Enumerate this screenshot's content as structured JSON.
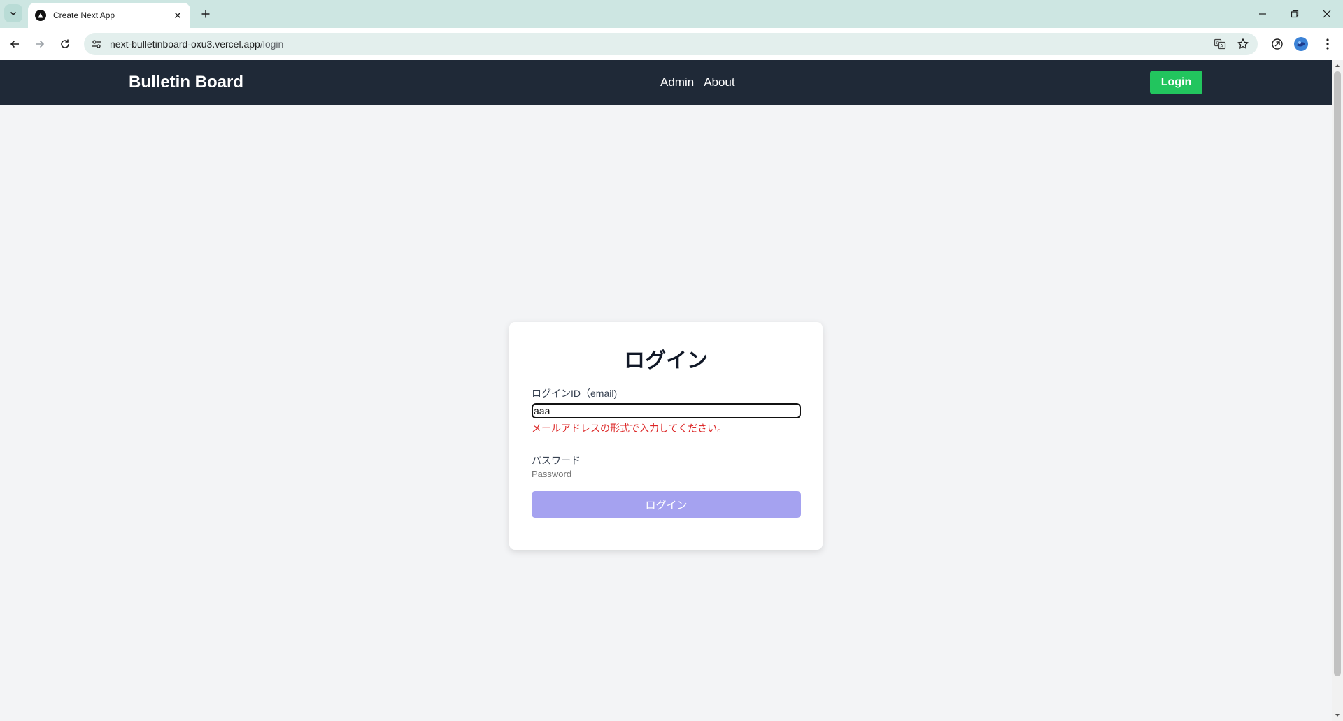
{
  "browser": {
    "tab_title": "Create Next App",
    "url_host": "next-bulletinboard-oxu3.vercel.app",
    "url_path": "/login"
  },
  "site": {
    "brand": "Bulletin Board",
    "nav": [
      "Admin",
      "About"
    ],
    "login_button": "Login"
  },
  "login_form": {
    "title": "ログイン",
    "email_label": "ログインID（email)",
    "email_value": "aaa",
    "email_error": "メールアドレスの形式で入力してください。",
    "password_label": "パスワード",
    "password_placeholder": "Password",
    "submit_label": "ログイン"
  },
  "colors": {
    "header_bg": "#1f2937",
    "login_button": "#22c55e",
    "error_text": "#dc2626",
    "submit_disabled": "#a5a2f0",
    "page_bg": "#f3f4f6"
  }
}
